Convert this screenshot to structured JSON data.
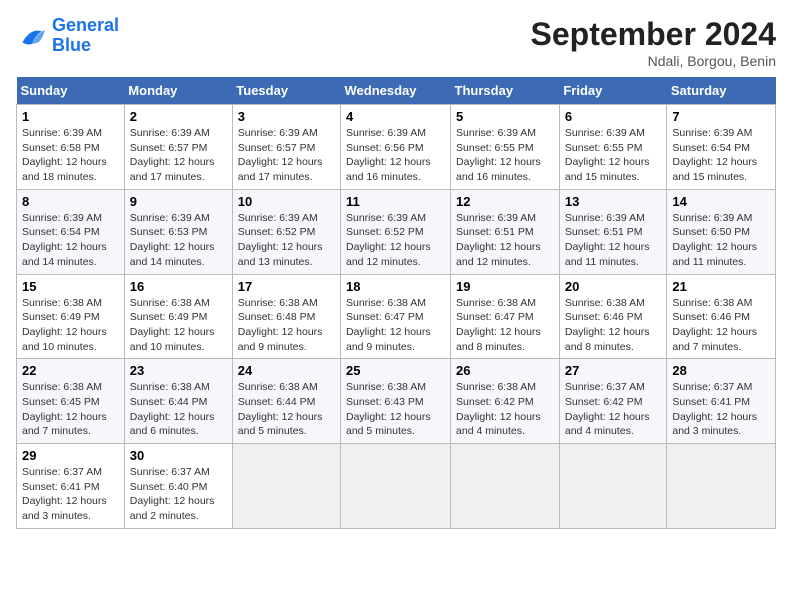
{
  "header": {
    "logo_line1": "General",
    "logo_line2": "Blue",
    "month_title": "September 2024",
    "location": "Ndali, Borgou, Benin"
  },
  "days_of_week": [
    "Sunday",
    "Monday",
    "Tuesday",
    "Wednesday",
    "Thursday",
    "Friday",
    "Saturday"
  ],
  "weeks": [
    [
      {
        "day": "1",
        "sunrise": "6:39 AM",
        "sunset": "6:58 PM",
        "daylight": "12 hours and 18 minutes."
      },
      {
        "day": "2",
        "sunrise": "6:39 AM",
        "sunset": "6:57 PM",
        "daylight": "12 hours and 17 minutes."
      },
      {
        "day": "3",
        "sunrise": "6:39 AM",
        "sunset": "6:57 PM",
        "daylight": "12 hours and 17 minutes."
      },
      {
        "day": "4",
        "sunrise": "6:39 AM",
        "sunset": "6:56 PM",
        "daylight": "12 hours and 16 minutes."
      },
      {
        "day": "5",
        "sunrise": "6:39 AM",
        "sunset": "6:55 PM",
        "daylight": "12 hours and 16 minutes."
      },
      {
        "day": "6",
        "sunrise": "6:39 AM",
        "sunset": "6:55 PM",
        "daylight": "12 hours and 15 minutes."
      },
      {
        "day": "7",
        "sunrise": "6:39 AM",
        "sunset": "6:54 PM",
        "daylight": "12 hours and 15 minutes."
      }
    ],
    [
      {
        "day": "8",
        "sunrise": "6:39 AM",
        "sunset": "6:54 PM",
        "daylight": "12 hours and 14 minutes."
      },
      {
        "day": "9",
        "sunrise": "6:39 AM",
        "sunset": "6:53 PM",
        "daylight": "12 hours and 14 minutes."
      },
      {
        "day": "10",
        "sunrise": "6:39 AM",
        "sunset": "6:52 PM",
        "daylight": "12 hours and 13 minutes."
      },
      {
        "day": "11",
        "sunrise": "6:39 AM",
        "sunset": "6:52 PM",
        "daylight": "12 hours and 12 minutes."
      },
      {
        "day": "12",
        "sunrise": "6:39 AM",
        "sunset": "6:51 PM",
        "daylight": "12 hours and 12 minutes."
      },
      {
        "day": "13",
        "sunrise": "6:39 AM",
        "sunset": "6:51 PM",
        "daylight": "12 hours and 11 minutes."
      },
      {
        "day": "14",
        "sunrise": "6:39 AM",
        "sunset": "6:50 PM",
        "daylight": "12 hours and 11 minutes."
      }
    ],
    [
      {
        "day": "15",
        "sunrise": "6:38 AM",
        "sunset": "6:49 PM",
        "daylight": "12 hours and 10 minutes."
      },
      {
        "day": "16",
        "sunrise": "6:38 AM",
        "sunset": "6:49 PM",
        "daylight": "12 hours and 10 minutes."
      },
      {
        "day": "17",
        "sunrise": "6:38 AM",
        "sunset": "6:48 PM",
        "daylight": "12 hours and 9 minutes."
      },
      {
        "day": "18",
        "sunrise": "6:38 AM",
        "sunset": "6:47 PM",
        "daylight": "12 hours and 9 minutes."
      },
      {
        "day": "19",
        "sunrise": "6:38 AM",
        "sunset": "6:47 PM",
        "daylight": "12 hours and 8 minutes."
      },
      {
        "day": "20",
        "sunrise": "6:38 AM",
        "sunset": "6:46 PM",
        "daylight": "12 hours and 8 minutes."
      },
      {
        "day": "21",
        "sunrise": "6:38 AM",
        "sunset": "6:46 PM",
        "daylight": "12 hours and 7 minutes."
      }
    ],
    [
      {
        "day": "22",
        "sunrise": "6:38 AM",
        "sunset": "6:45 PM",
        "daylight": "12 hours and 7 minutes."
      },
      {
        "day": "23",
        "sunrise": "6:38 AM",
        "sunset": "6:44 PM",
        "daylight": "12 hours and 6 minutes."
      },
      {
        "day": "24",
        "sunrise": "6:38 AM",
        "sunset": "6:44 PM",
        "daylight": "12 hours and 5 minutes."
      },
      {
        "day": "25",
        "sunrise": "6:38 AM",
        "sunset": "6:43 PM",
        "daylight": "12 hours and 5 minutes."
      },
      {
        "day": "26",
        "sunrise": "6:38 AM",
        "sunset": "6:42 PM",
        "daylight": "12 hours and 4 minutes."
      },
      {
        "day": "27",
        "sunrise": "6:37 AM",
        "sunset": "6:42 PM",
        "daylight": "12 hours and 4 minutes."
      },
      {
        "day": "28",
        "sunrise": "6:37 AM",
        "sunset": "6:41 PM",
        "daylight": "12 hours and 3 minutes."
      }
    ],
    [
      {
        "day": "29",
        "sunrise": "6:37 AM",
        "sunset": "6:41 PM",
        "daylight": "12 hours and 3 minutes."
      },
      {
        "day": "30",
        "sunrise": "6:37 AM",
        "sunset": "6:40 PM",
        "daylight": "12 hours and 2 minutes."
      },
      null,
      null,
      null,
      null,
      null
    ]
  ]
}
